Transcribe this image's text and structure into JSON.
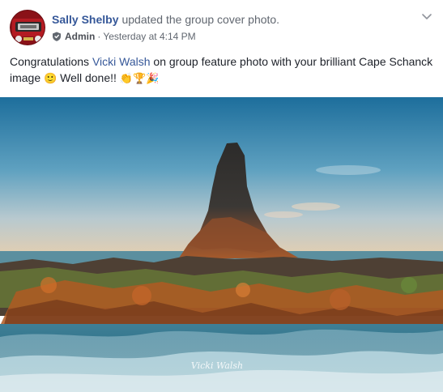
{
  "post": {
    "author": {
      "name": "Sally Shelby",
      "action": "updated the group cover photo."
    },
    "meta": {
      "role": "Admin",
      "separator": "·",
      "timestamp": "Yesterday at 4:14 PM"
    },
    "message": {
      "part1": "Congratulations",
      "mention": "Vicki Walsh",
      "part2": "on group feature photo with your brilliant Cape Schanck image",
      "emoji_smile": "🙂",
      "part3": "Well done!!",
      "emoji_trail": "👏🏆🎉"
    },
    "photo": {
      "watermark": "Vicki Walsh"
    }
  },
  "icons": {
    "admin_badge": "shield-icon",
    "post_menu": "chevron-down-icon"
  },
  "colors": {
    "link": "#365899",
    "meta_text": "#616770",
    "body_text": "#1d2129"
  }
}
